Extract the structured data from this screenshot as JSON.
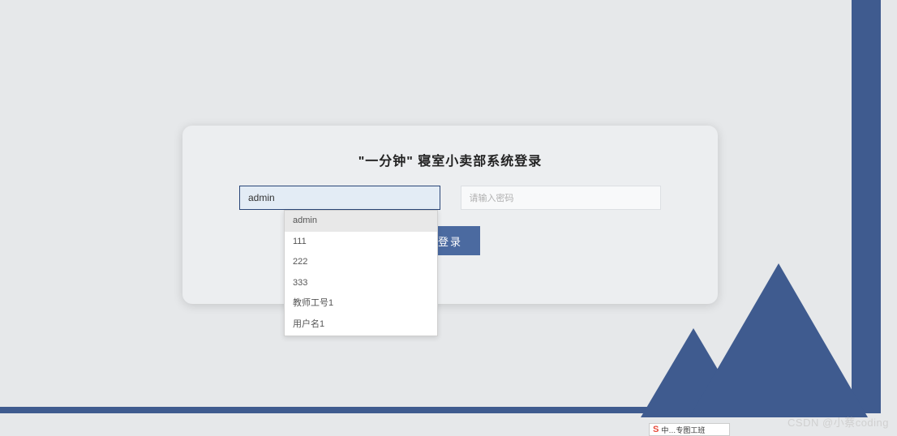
{
  "login": {
    "title": "\"一分钟\" 寝室小卖部系统登录",
    "username_value": "admin",
    "password_placeholder": "请输入密码",
    "submit_label": "登录",
    "autocomplete_options": [
      "admin",
      "111",
      "222",
      "333",
      "教师工号1",
      "用户名1"
    ]
  },
  "watermark": "CSDN @小蔡coding",
  "badge_text": "中…专图工班"
}
